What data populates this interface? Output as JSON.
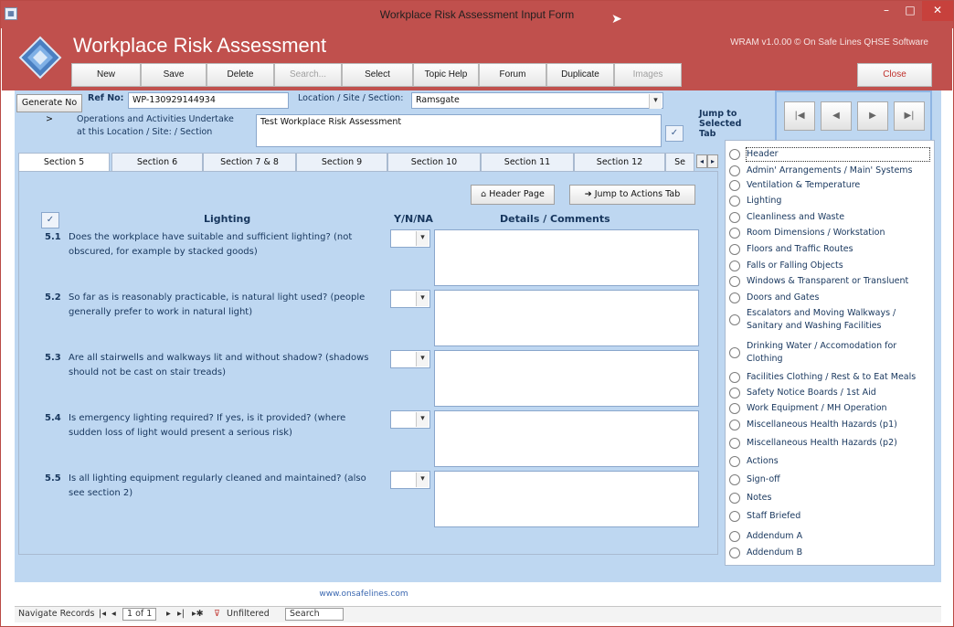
{
  "window": {
    "title": "Workplace Risk Assessment Input Form",
    "minimize": "–",
    "maximize": "□",
    "close": "✕"
  },
  "header": {
    "app_title": "Workplace Risk Assessment",
    "version": "WRAM v1.0.00 © On Safe Lines QHSE Software",
    "toolbar": {
      "new": "New",
      "save": "Save",
      "delete": "Delete",
      "search": "Search...",
      "select": "Select",
      "topic_help": "Topic Help",
      "forum": "Forum",
      "duplicate": "Duplicate",
      "images": "Images",
      "close": "Close"
    }
  },
  "form": {
    "generate_no": "Generate No >",
    "ref_label": "Ref No:",
    "ref_value": "WP-130929144934",
    "location_label": "Location / Site / Section:",
    "location_value": "Ramsgate",
    "ops_label_line1": "Operations and Activities Undertake",
    "ops_label_line2": "at this Location / Site: / Section",
    "ops_value": "Test Workplace Risk Assessment",
    "jump_to_tab": [
      "Jump to",
      "Selected",
      "Tab"
    ]
  },
  "tabs": [
    "Section 5",
    "Section 6",
    "Section 7 & 8",
    "Section 9",
    "Section 10",
    "Section 11",
    "Section 12",
    "Se"
  ],
  "panel": {
    "header_page_btn": "Header Page",
    "jump_actions_btn": "Jump to Actions Tab",
    "section_title": "Lighting",
    "yn_header": "Y/N/NA",
    "details_header": "Details / Comments",
    "questions": [
      {
        "num": "5.1",
        "text": "Does the workplace have suitable and sufficient lighting? (not obscured, for example by stacked goods)"
      },
      {
        "num": "5.2",
        "text": "So far as is reasonably practicable, is natural light used? (people generally prefer to work in natural light)"
      },
      {
        "num": "5.3",
        "text": "Are all stairwells and walkways lit and without shadow? (shadows should not be cast on stair treads)"
      },
      {
        "num": "5.4",
        "text": "Is emergency lighting required? If yes, is it provided? (where sudden loss of light would present a serious risk)"
      },
      {
        "num": "5.5",
        "text": "Is all lighting equipment regularly cleaned and maintained? (also see section 2)"
      }
    ]
  },
  "jump_list": [
    "Header",
    "Admin' Arrangements / Main' Systems",
    "Ventilation & Temperature",
    "Lighting",
    "Cleanliness and Waste",
    "Room Dimensions / Workstation",
    "Floors and Traffic Routes",
    "Falls or Falling Objects",
    "Windows & Transparent or Transluent",
    "Doors and Gates",
    "Escalators and Moving Walkways / Sanitary and Washing Facilities",
    "Drinking Water / Accomodation for Clothing",
    "Facilities Clothing / Rest & to Eat Meals",
    "Safety Notice Boards / 1st Aid",
    "Work Equipment / MH Operation",
    "Miscellaneous Health Hazards (p1)",
    "Miscellaneous Health Hazards (p2)",
    "Actions",
    "Sign-off",
    "Notes",
    "Staff Briefed",
    "Addendum A",
    "Addendum B"
  ],
  "footer": {
    "url": "www.onsafelines.com"
  },
  "status": {
    "navigate": "Navigate Records",
    "record": "1 of 1",
    "filter": "Unfiltered",
    "search": "Search"
  },
  "colors": {
    "brand": "#c0504d",
    "form_bg": "#bed7f1",
    "label": "#17365d"
  }
}
